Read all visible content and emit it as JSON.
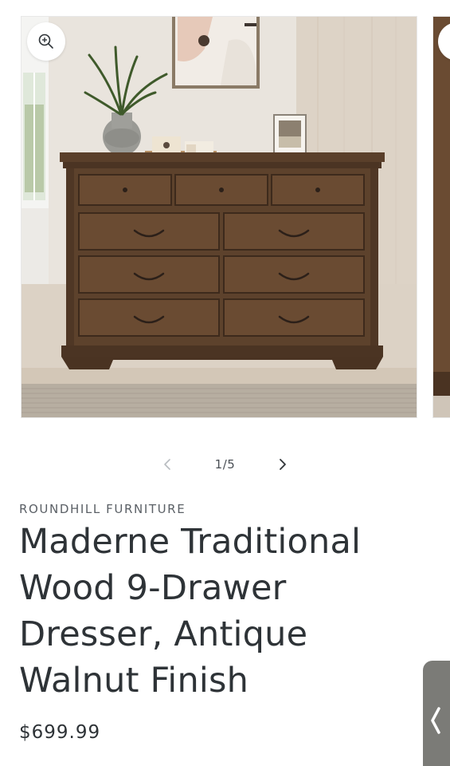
{
  "gallery": {
    "current_slide": 1,
    "total_slides": 5,
    "counter_text": "1/5",
    "image_alt": "Maderne Traditional Wood 9-Drawer Dresser, Antique Walnut Finish",
    "icons": {
      "zoom": "zoom-in-icon",
      "prev": "chevron-left-icon",
      "next": "chevron-right-icon"
    }
  },
  "product": {
    "vendor": "ROUNDHILL FURNITURE",
    "title_lines": [
      "Maderne Traditional",
      "Wood 9-Drawer",
      "Dresser, Antique",
      "Walnut Finish"
    ],
    "price": "$699.99"
  },
  "side_tab": {
    "icon": "chevron-left-icon"
  },
  "colors": {
    "text": "#2e3337",
    "muted": "#5b6066",
    "dresser": "#5a3f2a",
    "tab": "#7b7b77"
  }
}
